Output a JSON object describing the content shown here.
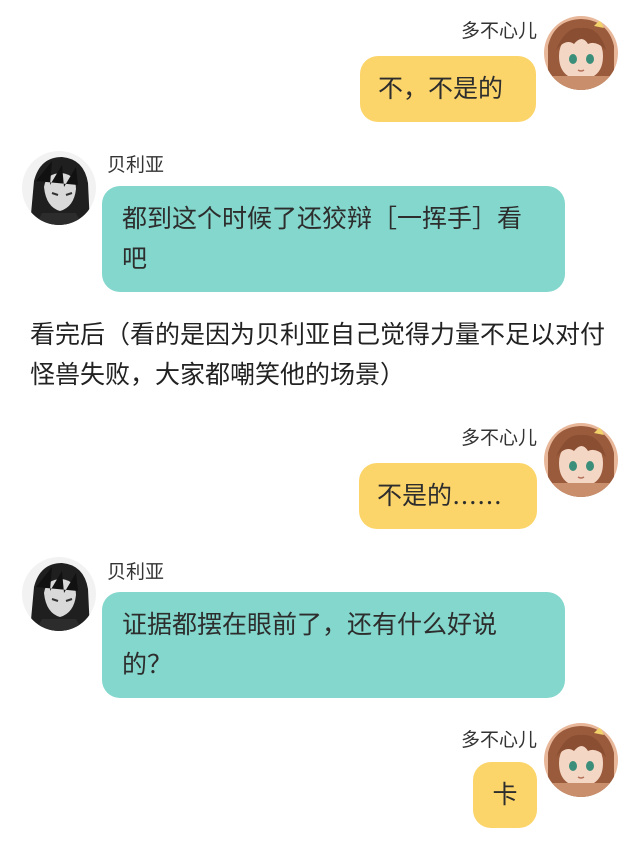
{
  "messages": [
    {
      "sender": "多不心儿",
      "text": "不，不是的",
      "side": "right",
      "color": "#fbd46a"
    },
    {
      "sender": "贝利亚",
      "text": "都到这个时候了还狡辩［一挥手］看吧",
      "side": "left",
      "color": "#83d7cc"
    },
    {
      "sender": "多不心儿",
      "text": "不是的……",
      "side": "right",
      "color": "#fbd46a"
    },
    {
      "sender": "贝利亚",
      "text": "证据都摆在眼前了，还有什么好说的？",
      "side": "left",
      "color": "#83d7cc"
    },
    {
      "sender": "多不心儿",
      "text": "卡",
      "side": "right",
      "color": "#fbd46a"
    }
  ],
  "narration": "看完后（看的是因为贝利亚自己觉得力量不足以对付怪兽失败，大家都嘲笑他的场景）",
  "colors": {
    "right_bubble": "#fbd46a",
    "left_bubble": "#83d7cc",
    "background": "#ffffff"
  },
  "icons": {
    "right_avatar": "anime-girl-avatar-icon",
    "left_avatar": "dark-haired-character-avatar-icon"
  }
}
